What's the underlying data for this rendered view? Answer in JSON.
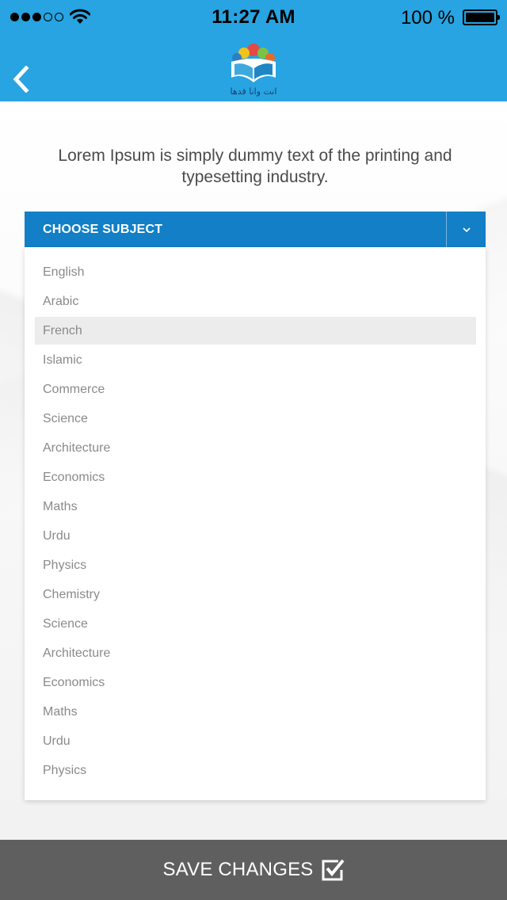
{
  "status_bar": {
    "time": "11:27 AM",
    "battery_text": "100 %",
    "signal_filled": 3,
    "signal_total": 5
  },
  "header": {
    "background_color": "#27a4e1",
    "logo_text": "انت وانا قدها",
    "back_icon": "chevron-left-icon"
  },
  "intro": {
    "text": "Lorem Ipsum is simply dummy text of the printing and typesetting industry."
  },
  "subject_dropdown": {
    "label": "CHOOSE SUBJECT",
    "color": "#127fc6",
    "caret_icon": "chevron-down-icon",
    "selected": "French",
    "options": [
      "English",
      "Arabic",
      "French",
      "Islamic",
      "Commerce",
      "Science",
      "Architecture",
      "Economics",
      "Maths",
      "Urdu",
      "Physics",
      "Chemistry",
      "Science",
      "Architecture",
      "Economics",
      "Maths",
      "Urdu",
      "Physics"
    ]
  },
  "footer": {
    "save_label": "SAVE CHANGES",
    "save_icon": "checkbox-checked-icon",
    "background_color": "#5f5f5f"
  }
}
